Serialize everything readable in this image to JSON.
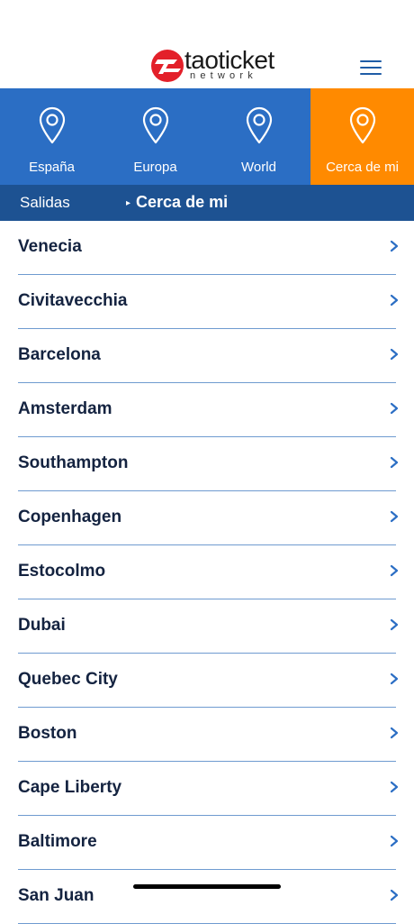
{
  "header": {
    "logo_text": "taoticket",
    "logo_sub": "network"
  },
  "tabs": [
    {
      "label": "España",
      "active": false
    },
    {
      "label": "Europa",
      "active": false
    },
    {
      "label": "World",
      "active": false
    },
    {
      "label": "Cerca de mi",
      "active": true
    }
  ],
  "subbar": {
    "salidas": "Salidas",
    "current": "Cerca de mi"
  },
  "cities": [
    "Venecia",
    "Civitavecchia",
    "Barcelona",
    "Amsterdam",
    "Southampton",
    "Copenhagen",
    "Estocolmo",
    "Dubai",
    "Quebec City",
    "Boston",
    "Cape Liberty",
    "Baltimore",
    "San Juan"
  ],
  "colors": {
    "tab_bg": "#2b6ec4",
    "tab_active": "#ff8a00",
    "subbar_bg": "#1d5292",
    "row_divider": "#6f9bd0",
    "chevron": "#2b6ec4"
  },
  "icons": {
    "tab_icon": "location-pin-icon",
    "row_icon": "chevron-right-icon",
    "menu_icon": "hamburger-menu-icon"
  }
}
